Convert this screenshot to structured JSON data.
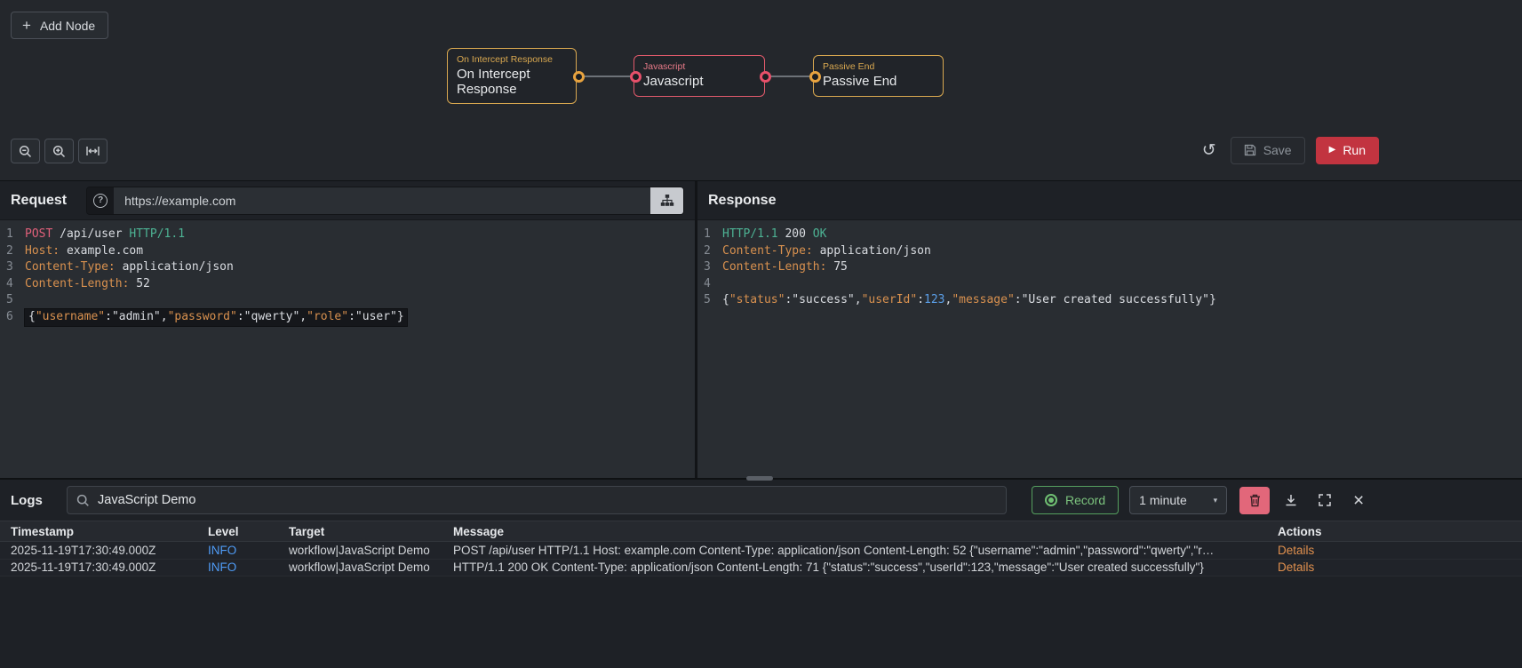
{
  "colors": {
    "node_yellow": "#d9a850",
    "node_red": "#e15a6b",
    "run_button_red": "#c23440",
    "record_green": "#6fbf72",
    "trash_pink": "#e2677a",
    "info_blue": "#4f9cf7",
    "details_orange": "#e0904e"
  },
  "canvas": {
    "add_node": "Add Node",
    "nodes": [
      {
        "type": "On Intercept Response",
        "title": "On Intercept Response",
        "color": "#d9a850"
      },
      {
        "type": "Javascript",
        "title": "Javascript",
        "color": "#e15a6b"
      },
      {
        "type": "Passive End",
        "title": "Passive End",
        "color": "#d9a850"
      }
    ],
    "toolbar": {
      "save": "Save",
      "run": "Run"
    }
  },
  "request": {
    "title": "Request",
    "url": "https://example.com",
    "lines": [
      {
        "n": "1",
        "tokens": [
          {
            "t": "POST",
            "c": "mth"
          },
          {
            "t": " /api/user ",
            "c": "pln"
          },
          {
            "t": "HTTP/1.1",
            "c": "ver"
          }
        ]
      },
      {
        "n": "2",
        "tokens": [
          {
            "t": "Host:",
            "c": "key"
          },
          {
            "t": " example.com",
            "c": "pln"
          }
        ]
      },
      {
        "n": "3",
        "tokens": [
          {
            "t": "Content-Type:",
            "c": "key"
          },
          {
            "t": " application/json",
            "c": "pln"
          }
        ]
      },
      {
        "n": "4",
        "tokens": [
          {
            "t": "Content-Length:",
            "c": "key"
          },
          {
            "t": " 52",
            "c": "pln"
          }
        ]
      },
      {
        "n": "5",
        "tokens": []
      },
      {
        "n": "6",
        "hl": true,
        "tokens": [
          {
            "t": "{",
            "c": "pln"
          },
          {
            "t": "\"username\"",
            "c": "key"
          },
          {
            "t": ":",
            "c": "pln"
          },
          {
            "t": "\"admin\"",
            "c": "str"
          },
          {
            "t": ",",
            "c": "pln"
          },
          {
            "t": "\"password\"",
            "c": "key"
          },
          {
            "t": ":",
            "c": "pln"
          },
          {
            "t": "\"qwerty\"",
            "c": "str"
          },
          {
            "t": ",",
            "c": "pln"
          },
          {
            "t": "\"role\"",
            "c": "key"
          },
          {
            "t": ":",
            "c": "pln"
          },
          {
            "t": "\"user\"",
            "c": "str"
          },
          {
            "t": "}",
            "c": "pln"
          }
        ]
      }
    ]
  },
  "response": {
    "title": "Response",
    "lines": [
      {
        "n": "1",
        "tokens": [
          {
            "t": "HTTP/1.1",
            "c": "ver"
          },
          {
            "t": " 200 ",
            "c": "pln"
          },
          {
            "t": "OK",
            "c": "ver"
          }
        ]
      },
      {
        "n": "2",
        "tokens": [
          {
            "t": "Content-Type:",
            "c": "key"
          },
          {
            "t": " application/json",
            "c": "pln"
          }
        ]
      },
      {
        "n": "3",
        "tokens": [
          {
            "t": "Content-Length:",
            "c": "key"
          },
          {
            "t": " 75",
            "c": "pln"
          }
        ]
      },
      {
        "n": "4",
        "tokens": []
      },
      {
        "n": "5",
        "tokens": [
          {
            "t": "{",
            "c": "pln"
          },
          {
            "t": "\"status\"",
            "c": "key"
          },
          {
            "t": ":",
            "c": "pln"
          },
          {
            "t": "\"success\"",
            "c": "str"
          },
          {
            "t": ",",
            "c": "pln"
          },
          {
            "t": "\"userId\"",
            "c": "key"
          },
          {
            "t": ":",
            "c": "pln"
          },
          {
            "t": "123",
            "c": "num"
          },
          {
            "t": ",",
            "c": "pln"
          },
          {
            "t": "\"message\"",
            "c": "key"
          },
          {
            "t": ":",
            "c": "pln"
          },
          {
            "t": "\"User created successfully\"",
            "c": "str"
          },
          {
            "t": "}",
            "c": "pln"
          }
        ]
      }
    ]
  },
  "logs": {
    "title": "Logs",
    "search": "JavaScript Demo",
    "record": "Record",
    "interval": "1 minute",
    "columns": [
      "Timestamp",
      "Level",
      "Target",
      "Message",
      "Actions"
    ],
    "rows": [
      {
        "timestamp": "2025-11-19T17:30:49.000Z",
        "level": "INFO",
        "target": "workflow|JavaScript Demo",
        "message": "POST /api/user HTTP/1.1 Host: example.com Content-Type: application/json Content-Length: 52 {\"username\":\"admin\",\"password\":\"qwerty\",\"r…",
        "action": "Details"
      },
      {
        "timestamp": "2025-11-19T17:30:49.000Z",
        "level": "INFO",
        "target": "workflow|JavaScript Demo",
        "message": "HTTP/1.1 200 OK Content-Type: application/json Content-Length: 71 {\"status\":\"success\",\"userId\":123,\"message\":\"User created successfully\"}",
        "action": "Details"
      }
    ]
  }
}
